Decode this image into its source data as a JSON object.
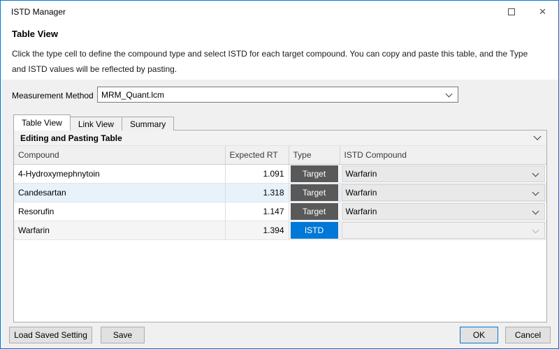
{
  "window": {
    "title": "ISTD Manager"
  },
  "icons": {
    "close": "×",
    "maximize": "css-border-box",
    "chevron_down": "css-chevron"
  },
  "colors": {
    "accent": "#0078d7",
    "type_target_bg": "#595959",
    "type_istd_bg": "#0078d7",
    "row_highlight": "#e7f2fb",
    "row_alt": "#f5f5f5"
  },
  "header": {
    "title": "Table View",
    "description": "Click the type cell to define the compound type and select ISTD for each target compound. You can copy and paste this table, and the Type and ISTD values will be reflected by pasting."
  },
  "measurement_method": {
    "label": "Measurement Method",
    "value": "MRM_Quant.lcm"
  },
  "tabs": {
    "active_index": 0,
    "items": [
      {
        "label": "Table View"
      },
      {
        "label": "Link View"
      },
      {
        "label": "Summary"
      }
    ]
  },
  "section": {
    "title": "Editing and Pasting Table"
  },
  "table": {
    "columns": [
      "Compound",
      "Expected RT",
      "Type",
      "ISTD Compound"
    ],
    "rows": [
      {
        "compound": "4-Hydroxymephnytoin",
        "expected_rt": "1.091",
        "type": "Target",
        "istd_compound": "Warfarin",
        "row_bg": "#ffffff"
      },
      {
        "compound": "Candesartan",
        "expected_rt": "1.318",
        "type": "Target",
        "istd_compound": "Warfarin",
        "row_bg": "#e7f2fb"
      },
      {
        "compound": "Resorufin",
        "expected_rt": "1.147",
        "type": "Target",
        "istd_compound": "Warfarin",
        "row_bg": "#ffffff"
      },
      {
        "compound": "Warfarin",
        "expected_rt": "1.394",
        "type": "ISTD",
        "istd_compound": "",
        "row_bg": "#f5f5f5"
      }
    ]
  },
  "footer": {
    "load": "Load Saved Setting",
    "save": "Save",
    "ok": "OK",
    "cancel": "Cancel"
  }
}
